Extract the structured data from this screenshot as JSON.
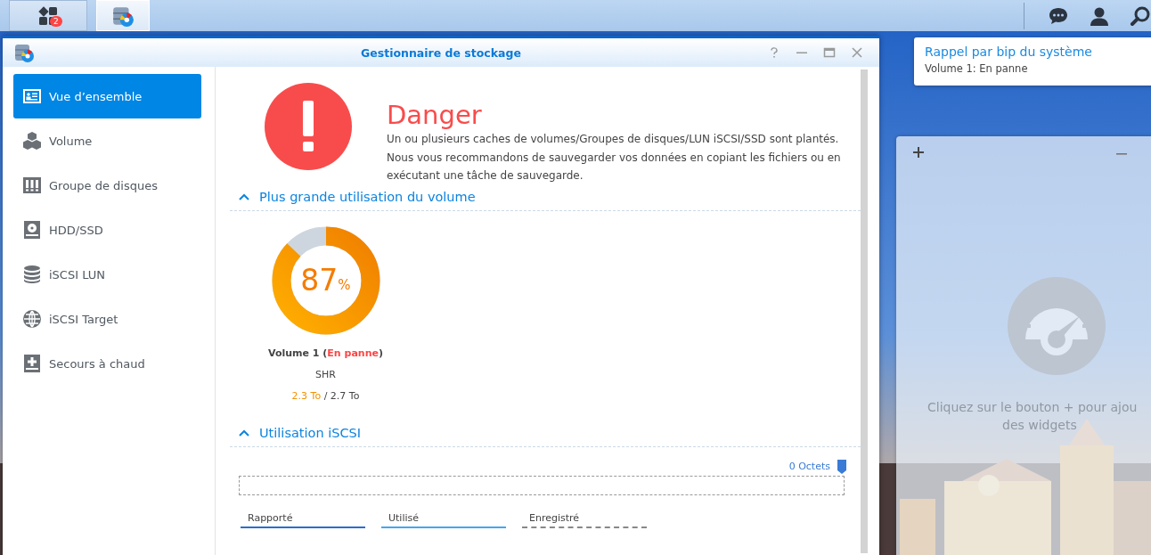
{
  "taskbar": {
    "apps": [
      {
        "kind": "main_menu",
        "badge": "2",
        "selected": false
      },
      {
        "kind": "storage",
        "selected": true
      }
    ],
    "tray": [
      {
        "kind": "chat"
      },
      {
        "kind": "user"
      },
      {
        "kind": "search"
      }
    ]
  },
  "window": {
    "title": "Gestionnaire de stockage"
  },
  "sidebar": {
    "items": [
      {
        "label": "Vue d’ensemble",
        "selected": true
      },
      {
        "label": "Volume",
        "selected": false
      },
      {
        "label": "Groupe de disques",
        "selected": false
      },
      {
        "label": "HDD/SSD",
        "selected": false
      },
      {
        "label": "iSCSI LUN",
        "selected": false
      },
      {
        "label": "iSCSI Target",
        "selected": false
      },
      {
        "label": "Secours à chaud",
        "selected": false
      }
    ]
  },
  "status": {
    "title": "Danger",
    "message": "Un ou plusieurs caches de volumes/Groupes de disques/LUN iSCSI/SSD sont plantés. Nous vous recommandons de sauvegarder vos données en copiant les fichiers ou en exécutant une tâche de sauvegarde."
  },
  "volume_section": {
    "heading": "Plus grande utilisation du volume",
    "expanded": true,
    "volumes": [
      {
        "level": 0.87,
        "percent": "87",
        "unit": "%",
        "name": "Volume 1",
        "open": "(",
        "status": "En panne",
        "close": ")",
        "raid": "SHR",
        "used": "2.3 To",
        "separator": "/",
        "total": "2.7 To"
      }
    ]
  },
  "iscsi_section": {
    "heading": "Utilisation iSCSI",
    "expanded": true,
    "total_label": "0 Octets",
    "legend": [
      {
        "label": "Rapporté",
        "kind": "reported"
      },
      {
        "label": "Utilisé",
        "kind": "used"
      },
      {
        "label": "Enregistré",
        "kind": "recorded"
      }
    ]
  },
  "notification": {
    "title": "Rappel par bip du système",
    "message": "Volume 1: En panne"
  },
  "widget_panel": {
    "hint_lines": [
      "Cliquez sur le bouton + pour ajou",
      "des widgets"
    ]
  }
}
